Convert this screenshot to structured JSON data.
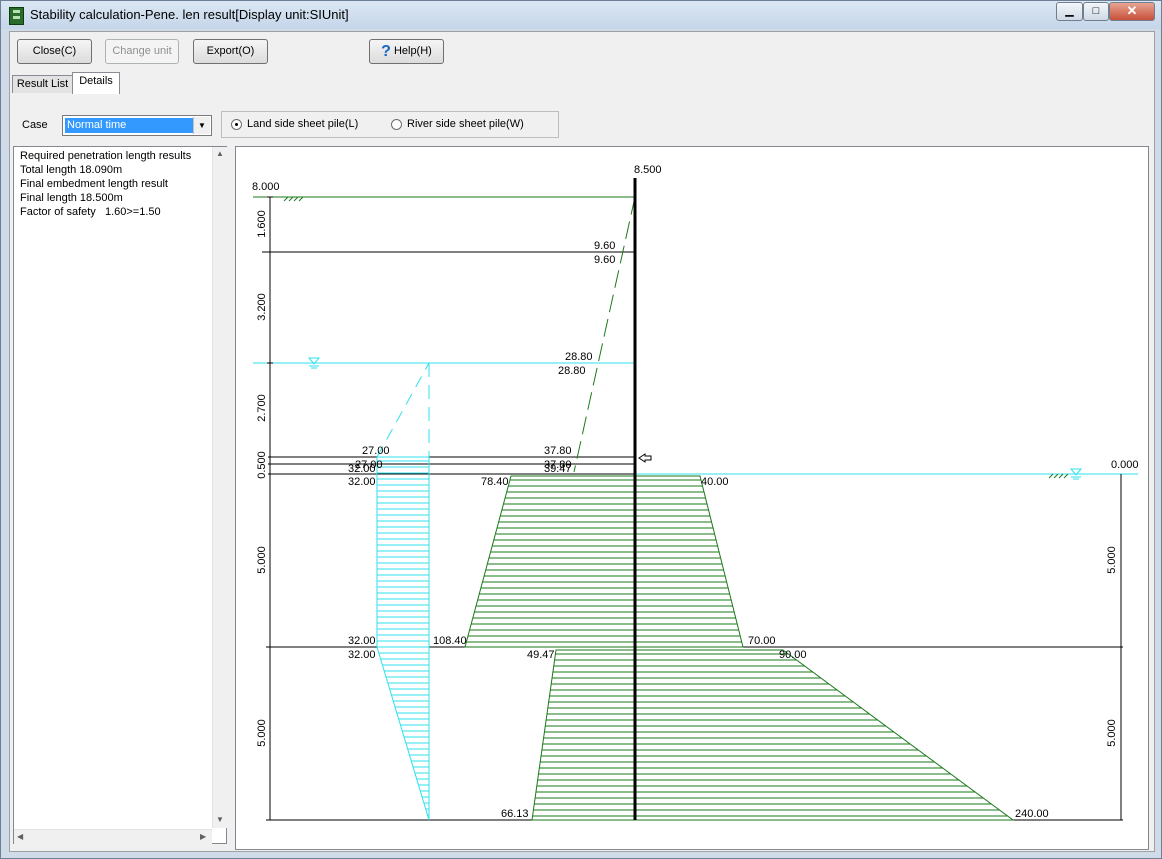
{
  "window": {
    "title": "Stability calculation-Pene. len result[Display unit:SIUnit]"
  },
  "toolbar": {
    "close_label": "Close(C)",
    "change_unit_label": "Change unit",
    "export_label": "Export(O)",
    "help_label": "Help(H)"
  },
  "tabs": [
    {
      "label": "Result List"
    },
    {
      "label": "Details"
    }
  ],
  "case": {
    "label": "Case",
    "selected": "Normal time"
  },
  "radios": [
    {
      "label": "Land side sheet pile(L)",
      "checked": true
    },
    {
      "label": "River side sheet pile(W)",
      "checked": false
    }
  ],
  "results": [
    "Required penetration length results",
    "Total length 18.090m",
    "Final embedment length result",
    "Final length 18.500m",
    "Factor of safety   1.60>=1.50"
  ],
  "diagram": {
    "pile_top": "8.500",
    "left_top": "8.000",
    "right_level": "0.000",
    "left_dims": [
      "1.600",
      "3.200",
      "2.700",
      "0.500",
      "5.000",
      "5.000"
    ],
    "right_dims": [
      "5.000",
      "5.000"
    ],
    "labels": {
      "a1": "9.60",
      "a2": "9.60",
      "b1": "28.80",
      "b2": "28.80",
      "c1": "27.00",
      "c2": "37.80",
      "d1": "27.00",
      "d2": "37.80",
      "e1": "32.00",
      "e2": "39.47",
      "f1": "32.00",
      "f2": "78.40",
      "f3": "40.00",
      "g1": "32.00",
      "g2": "108.40",
      "g3": "70.00",
      "h1": "32.00",
      "h2": "49.47",
      "h3": "90.00",
      "i1": "66.13",
      "i2": "240.00"
    },
    "colors": {
      "earth": "#1a7a1a",
      "water": "#2fe0ee",
      "line": "#000000"
    }
  }
}
